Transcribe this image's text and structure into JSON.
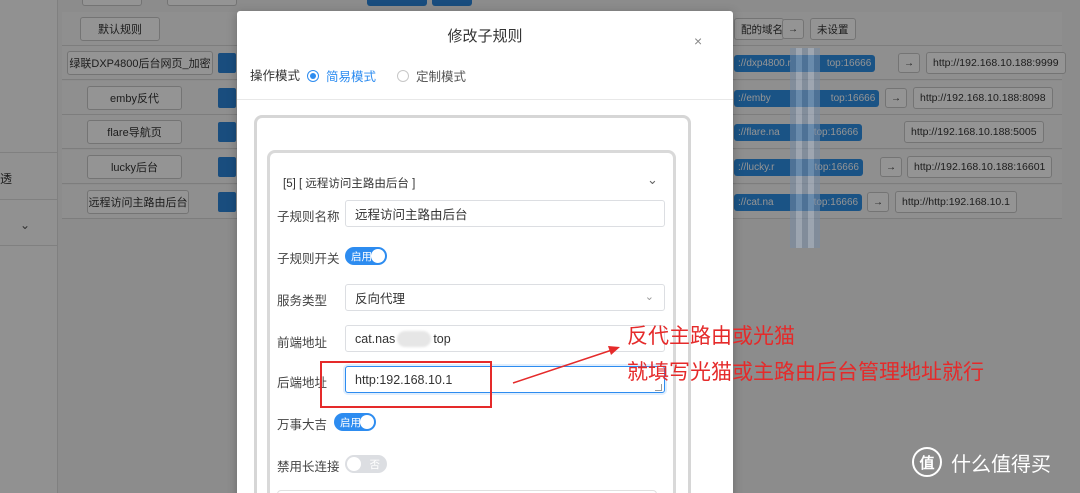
{
  "background": {
    "sidebar_text": "透",
    "sidebar_chevron": "⌄",
    "rows": [
      {
        "name": "默认规则",
        "front": "配的域名",
        "arrow": "→",
        "target": "未设置"
      },
      {
        "name": "绿联DXP4800后台网页_加密",
        "front": "://dxp4800.r",
        "front2": "top:16666",
        "arrow": "→",
        "target": "http://192.168.10.188:9999"
      },
      {
        "name": "emby反代",
        "front": "://emby",
        "front2": "top:16666",
        "arrow": "→",
        "target": "http://192.168.10.188:8098"
      },
      {
        "name": "flare导航页",
        "front": "://flare.na",
        "front2": "top:16666",
        "arrow": "→",
        "target": "http://192.168.10.188:5005"
      },
      {
        "name": "lucky后台",
        "front": "://lucky.r",
        "front2": "top:16666",
        "arrow": "→",
        "target": "http://192.168.10.188:16601"
      },
      {
        "name": "远程访问主路由后台",
        "front": "://cat.na",
        "front2": "top:16666",
        "arrow": "→",
        "target": "http://http:192.168.10.1"
      }
    ]
  },
  "modal": {
    "title": "修改子规则",
    "close_icon": "×",
    "mode_label": "操作模式",
    "mode_simple": "简易模式",
    "mode_custom": "定制模式",
    "subrule": {
      "header": "[5] [ 远程访问主路由后台 ]",
      "chevron": "⌄",
      "name_label": "子规则名称",
      "name_value": "远程访问主路由后台",
      "switch_label": "子规则开关",
      "switch_text": "启用",
      "service_label": "服务类型",
      "service_value": "反向代理",
      "service_arrow": "⌄",
      "frontend_label": "前端地址",
      "frontend_value_a": "cat.nas",
      "frontend_value_b": "top",
      "backend_label": "后端地址",
      "backend_value": "http:192.168.10.1",
      "wanshi_label": "万事大吉",
      "wanshi_text": "启用",
      "longconn_label": "禁用长连接",
      "longconn_text": "否"
    }
  },
  "annotation": {
    "line1": "反代主路由或光猫",
    "line2": "就填写光猫或主路由后台管理地址就行"
  },
  "watermark": {
    "logo": "值",
    "text": "什么值得买"
  }
}
